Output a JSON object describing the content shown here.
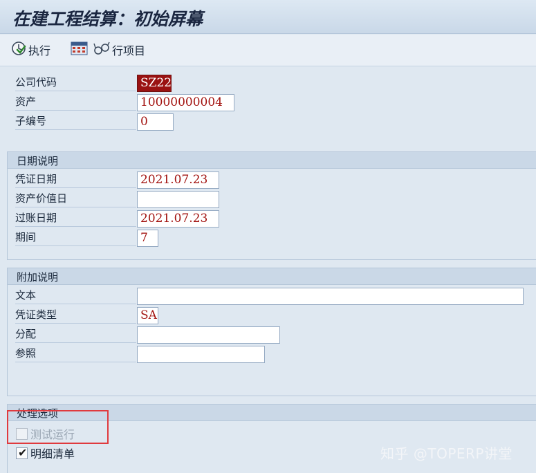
{
  "window": {
    "title": "在建工程结算：初始屏幕"
  },
  "toolbar": {
    "execute_label": "执行",
    "line_items_label": "行项目"
  },
  "header_fields": {
    "company_code": {
      "label": "公司代码",
      "value": "SZ22"
    },
    "asset": {
      "label": "资产",
      "value": "10000000004"
    },
    "sub_number": {
      "label": "子编号",
      "value": "0"
    }
  },
  "date_section": {
    "title": "日期说明",
    "doc_date": {
      "label": "凭证日期",
      "value": "2021.07.23"
    },
    "asset_value_date": {
      "label": "资产价值日",
      "value": ""
    },
    "posting_date": {
      "label": "过账日期",
      "value": "2021.07.23"
    },
    "period": {
      "label": "期间",
      "value": "7"
    }
  },
  "extra_section": {
    "title": "附加说明",
    "text": {
      "label": "文本",
      "value": ""
    },
    "doc_type": {
      "label": "凭证类型",
      "value": "SA"
    },
    "assignment": {
      "label": "分配",
      "value": ""
    },
    "reference": {
      "label": "参照",
      "value": ""
    }
  },
  "processing_section": {
    "title": "处理选项",
    "test_run": {
      "label": "测试运行",
      "checked": false,
      "enabled": false
    },
    "detail_list": {
      "label": "明细清单",
      "checked": true,
      "enabled": true
    }
  },
  "watermark": "知乎 @TOPERP讲堂",
  "colors": {
    "highlight_box": "#e03a3e",
    "field_value_text": "#a2120f",
    "selected_field_bg": "#9a1212"
  }
}
